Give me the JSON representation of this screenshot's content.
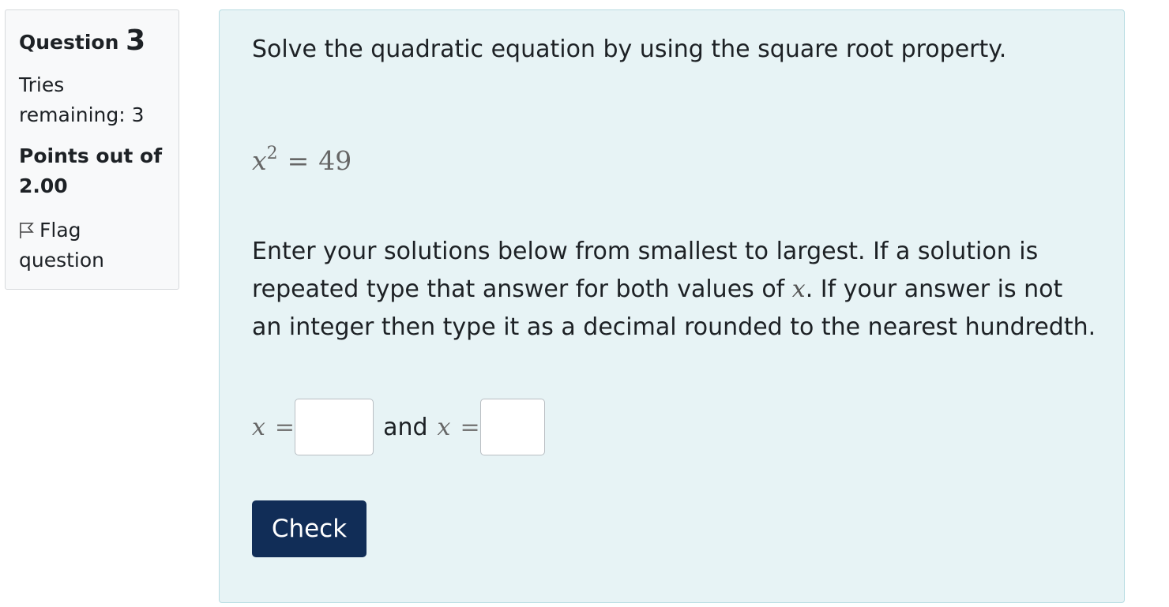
{
  "info": {
    "question_word": "Question",
    "question_number": "3",
    "tries_label": "Tries remaining:",
    "tries_value": "3",
    "points_label": "Points out of",
    "points_value": "2.00",
    "flag_label": "Flag question"
  },
  "question": {
    "prompt": "Solve the quadratic equation by using the square root property.",
    "equation_var": "x",
    "equation_exp": "2",
    "equation_op": "=",
    "equation_rhs": "49",
    "instructions_part1": "Enter your solutions below from smallest to largest. If a solution is repeated type that answer for both values of ",
    "instructions_var": "x",
    "instructions_part2": ". If your answer is not an integer then type it as a decimal rounded to the nearest hundredth.",
    "answer_var": "x",
    "answer_eq": "=",
    "answer1_value": "",
    "and_label": "and",
    "answer2_value": "",
    "check_label": "Check"
  },
  "colors": {
    "content_bg": "#e7f3f5",
    "button_bg": "#112d57"
  },
  "icons": {
    "flag": "flag-icon"
  }
}
